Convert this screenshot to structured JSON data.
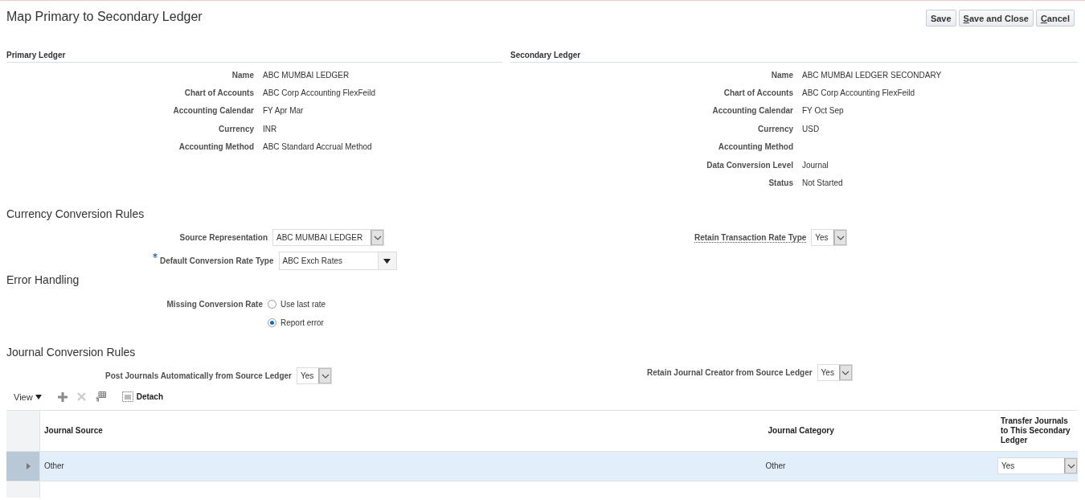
{
  "page": {
    "title": "Map Primary to Secondary Ledger"
  },
  "buttons": [
    {
      "label": "Save"
    },
    {
      "mnemonic": "S",
      "rest": "ave and Close"
    },
    {
      "mnemonic": "C",
      "rest": "ancel"
    }
  ],
  "primary_ledger": {
    "heading": "Primary Ledger",
    "fields": [
      {
        "label": "Name",
        "value": "ABC MUMBAI LEDGER"
      },
      {
        "label": "Chart of Accounts",
        "value": "ABC Corp Accounting FlexFeild"
      },
      {
        "label": "Accounting Calendar",
        "value": "FY Apr Mar"
      },
      {
        "label": "Currency",
        "value": "INR"
      },
      {
        "label": "Accounting Method",
        "value": "ABC Standard Accrual Method"
      }
    ]
  },
  "secondary_ledger": {
    "heading": "Secondary Ledger",
    "fields": [
      {
        "label": "Name",
        "value": "ABC MUMBAI LEDGER SECONDARY"
      },
      {
        "label": "Chart of Accounts",
        "value": "ABC Corp Accounting FlexFeild"
      },
      {
        "label": "Accounting Calendar",
        "value": "FY Oct Sep"
      },
      {
        "label": "Currency",
        "value": "USD"
      },
      {
        "label": "Accounting Method"
      },
      {
        "label": "Data Conversion Level",
        "value": "Journal"
      },
      {
        "label": "Status",
        "value": "Not Started"
      }
    ]
  },
  "currency_conversion_rules": {
    "heading": "Currency Conversion Rules",
    "source_representation": {
      "label": "Source Representation",
      "value": "ABC MUMBAI LEDGER",
      "kind": "select"
    },
    "retain_transaction_rate_type": {
      "label": "Retain Transaction Rate Type",
      "value": "Yes",
      "kind": "select"
    },
    "default_conversion_rate_type": {
      "label": "Default Conversion Rate Type",
      "value": "ABC Exch Rates",
      "kind": "choice",
      "required": true
    }
  },
  "error_handling": {
    "heading": "Error Handling",
    "missing_conversion_rate": {
      "label": "Missing Conversion Rate",
      "options": [
        {
          "label": "Use last rate",
          "selected": false
        },
        {
          "label": "Report error",
          "selected": true
        }
      ]
    }
  },
  "journal_conversion_rules": {
    "heading": "Journal Conversion Rules",
    "post_journals_automatically": {
      "label": "Post Journals Automatically from Source Ledger",
      "value": "Yes",
      "kind": "select"
    },
    "retain_journal_creator": {
      "label": "Retain Journal Creator from Source Ledger",
      "value": "Yes",
      "kind": "select"
    }
  },
  "toolbar": {
    "view": "View",
    "detach": "Detach"
  },
  "table": {
    "columns": [
      "Journal Source",
      "Journal Category",
      "Transfer Journals to This Secondary Ledger"
    ],
    "rows": [
      {
        "journal_source": "Other",
        "journal_category": "Other",
        "transfer": "Yes",
        "selected": true
      }
    ]
  }
}
